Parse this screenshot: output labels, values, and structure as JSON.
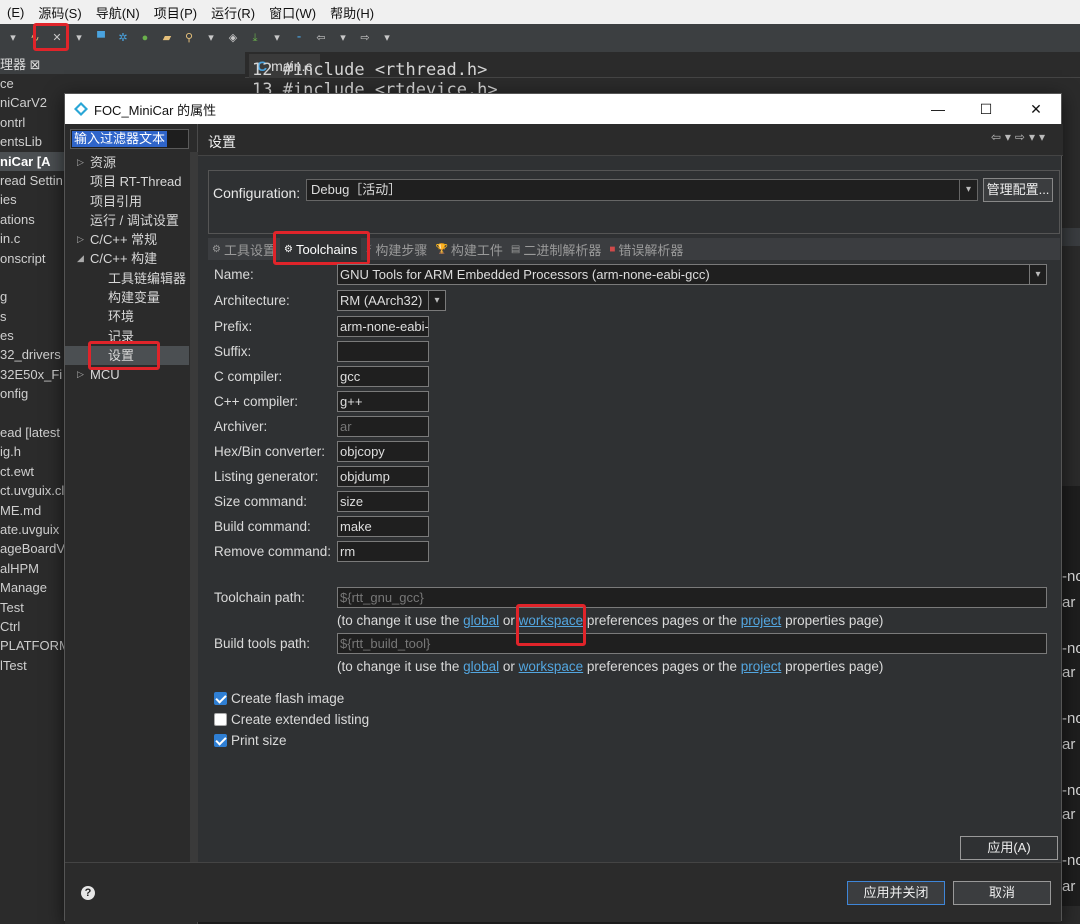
{
  "ide": {
    "menu": [
      "(E)",
      "源码(S)",
      "导航(N)",
      "项目(P)",
      "运行(R)",
      "窗口(W)",
      "帮助(H)"
    ],
    "explorer_title": "理器 ⊠",
    "explorer_items": [
      "ce",
      "niCarV2",
      "ontrl",
      "entsLib",
      "niCar   [A",
      "read Settin",
      "ies",
      "ations",
      "in.c",
      "onscript",
      "",
      "g",
      "s",
      "es",
      "32_drivers",
      "32E50x_Fi",
      "onfig",
      "",
      "ead [latest",
      "ig.h",
      "ct.ewt",
      "ct.uvguix.cl",
      "ME.md",
      "ate.uvguix",
      "ageBoardV",
      "alHPM",
      "Manage",
      "Test",
      "Ctrl",
      "PLATFORM",
      "lTest"
    ],
    "editor_tab": "main.c",
    "editor_tab_icon": "C",
    "code_lines": [
      "12 #include <rthread.h>",
      "13 #include <rtdevice.h>"
    ],
    "right_peek": [
      "-no",
      "ar",
      "-no",
      "ar",
      "-no",
      "ar",
      "-no",
      "ar",
      "-no",
      "ar"
    ]
  },
  "dialog": {
    "title": "FOC_MiniCar 的属性",
    "filter_placeholder": "输入过滤器文本",
    "tree": [
      {
        "label": "资源",
        "arrow": "▷",
        "indent": 0
      },
      {
        "label": "项目 RT-Thread",
        "arrow": "",
        "indent": 0
      },
      {
        "label": "项目引用",
        "arrow": "",
        "indent": 0
      },
      {
        "label": "运行 / 调试设置",
        "arrow": "",
        "indent": 0
      },
      {
        "label": "C/C++ 常规",
        "arrow": "▷",
        "indent": 0
      },
      {
        "label": "C/C++ 构建",
        "arrow": "◢",
        "indent": 0
      },
      {
        "label": "工具链编辑器",
        "arrow": "",
        "indent": 1
      },
      {
        "label": "构建变量",
        "arrow": "",
        "indent": 1
      },
      {
        "label": "环境",
        "arrow": "",
        "indent": 1
      },
      {
        "label": "记录",
        "arrow": "",
        "indent": 1
      },
      {
        "label": "设置",
        "arrow": "",
        "indent": 1,
        "selected": true
      },
      {
        "label": "MCU",
        "arrow": "▷",
        "indent": 0
      }
    ],
    "section_title": "设置",
    "configuration_label": "Configuration:",
    "configuration_value": "Debug［活动］",
    "manage_button": "管理配置...",
    "tabs": [
      {
        "label": "工具设置",
        "active": false
      },
      {
        "label": "Toolchains",
        "active": true
      },
      {
        "label": "构建步骤",
        "active": false
      },
      {
        "label": "构建工件",
        "active": false
      },
      {
        "label": "二进制解析器",
        "active": false
      },
      {
        "label": "错误解析器",
        "active": false
      }
    ],
    "fields": {
      "name": {
        "label": "Name:",
        "value": "GNU Tools for ARM Embedded Processors (arm-none-eabi-gcc)"
      },
      "architecture": {
        "label": "Architecture:",
        "value": "RM (AArch32)"
      },
      "prefix": {
        "label": "Prefix:",
        "value": "arm-none-eabi-"
      },
      "suffix": {
        "label": "Suffix:",
        "value": ""
      },
      "c_compiler": {
        "label": "C compiler:",
        "value": "gcc"
      },
      "cpp_compiler": {
        "label": "C++ compiler:",
        "value": "g++"
      },
      "archiver": {
        "label": "Archiver:",
        "value": "ar"
      },
      "hexbin": {
        "label": "Hex/Bin converter:",
        "value": "objcopy"
      },
      "listing": {
        "label": "Listing generator:",
        "value": "objdump"
      },
      "size": {
        "label": "Size command:",
        "value": "size"
      },
      "build": {
        "label": "Build command:",
        "value": "make"
      },
      "remove": {
        "label": "Remove command:",
        "value": "rm"
      },
      "toolchain_path": {
        "label": "Toolchain path:",
        "value": "${rtt_gnu_gcc}"
      },
      "build_tools_path": {
        "label": "Build tools path:",
        "value": "${rtt_build_tool}"
      }
    },
    "hint": {
      "pre": "(to change it use the ",
      "global": "global",
      "or": " or ",
      "workspace": "workspace",
      "mid": " preferences pages or the ",
      "project": "project",
      "post": " properties page)"
    },
    "checkboxes": [
      {
        "label": "Create flash image",
        "checked": true
      },
      {
        "label": "Create extended listing",
        "checked": false
      },
      {
        "label": "Print size",
        "checked": true
      }
    ],
    "apply_button": "应用(A)",
    "apply_close_button": "应用并关闭",
    "cancel_button": "取消",
    "help_glyph": "?",
    "colors": {
      "accent": "#2f7fd4",
      "link": "#53a6e0",
      "highlight_box": "#e0242a"
    }
  }
}
